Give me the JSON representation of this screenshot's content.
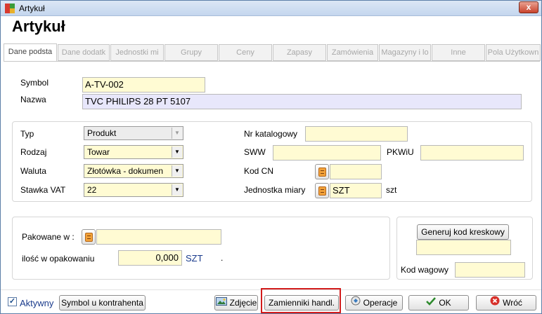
{
  "window": {
    "title": "Artykuł",
    "close_label": "x"
  },
  "page_title": "Artykuł",
  "tabs": [
    {
      "label": "Dane podsta",
      "active": true
    },
    {
      "label": "Dane dodatk"
    },
    {
      "label": "Jednostki mi"
    },
    {
      "label": "Grupy"
    },
    {
      "label": "Ceny"
    },
    {
      "label": "Zapasy"
    },
    {
      "label": "Zamówienia"
    },
    {
      "label": "Magazyny i lo"
    },
    {
      "label": "Inne"
    },
    {
      "label": "Pola Użytkown"
    }
  ],
  "basic": {
    "symbol_label": "Symbol",
    "symbol_value": "A-TV-002",
    "nazwa_label": "Nazwa",
    "nazwa_value": "TVC PHILIPS 28 PT 5107"
  },
  "left_fields": {
    "typ_label": "Typ",
    "typ_value": "Produkt",
    "rodzaj_label": "Rodzaj",
    "rodzaj_value": "Towar",
    "waluta_label": "Waluta",
    "waluta_value": "Złotówka - dokumen",
    "vat_label": "Stawka VAT",
    "vat_value": "22"
  },
  "right_fields": {
    "nr_label": "Nr katalogowy",
    "nr_value": "",
    "sww_label": "SWW",
    "sww_value": "",
    "pkwiu_label": "PKWiU",
    "pkwiu_value": "",
    "kodcn_label": "Kod CN",
    "kodcn_value": "",
    "jm_label": "Jednostka miary",
    "jm_value": "SZT",
    "jm_unit": "szt"
  },
  "packaging": {
    "pakowane_label": "Pakowane w :",
    "pakowane_value": "",
    "ilosc_label": "ilość w opakowaniu",
    "ilosc_value": "0,000",
    "ilosc_unit": "SZT",
    "dot": "."
  },
  "barcode": {
    "generate_label": "Generuj kod kreskowy",
    "barcode_value": "",
    "kod_wagowy_label": "Kod wagowy",
    "kod_wagowy_value": ""
  },
  "footer": {
    "aktywny_label": "Aktywny",
    "aktywny_check": "✓",
    "symbol_kontrahenta_label": "Symbol u kontrahenta",
    "zdjecie_label": "Zdjęcie",
    "zamienniki_label": "Zamienniki handl.",
    "operacje_label": "Operacje",
    "ok_label": "OK",
    "wroc_label": "Wróć"
  },
  "colors": {
    "field_yellow": "#fffbd3",
    "field_lilac": "#e8e7fb",
    "highlight": "#d21b1b"
  }
}
